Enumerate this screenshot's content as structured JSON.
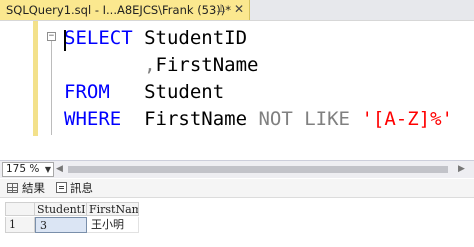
{
  "tab": {
    "title": "SQLQuery1.sql - I...A8EJCS\\Frank (53))*",
    "pin_glyph": "⊥",
    "close_glyph": "✕"
  },
  "editor": {
    "fold_glyph": "−",
    "lines": [
      [
        {
          "t": "SELECT",
          "c": "kw"
        },
        {
          "t": " StudentID",
          "c": "id"
        }
      ],
      [
        {
          "t": "       ",
          "c": "id"
        },
        {
          "t": ",",
          "c": "op"
        },
        {
          "t": "FirstName",
          "c": "id"
        }
      ],
      [
        {
          "t": "FROM",
          "c": "kw"
        },
        {
          "t": "   Student",
          "c": "id"
        }
      ],
      [
        {
          "t": "WHERE",
          "c": "kw"
        },
        {
          "t": "  FirstName ",
          "c": "id"
        },
        {
          "t": "NOT LIKE",
          "c": "op"
        },
        {
          "t": " ",
          "c": "id"
        },
        {
          "t": "'[A-Z]%'",
          "c": "str"
        }
      ]
    ]
  },
  "zoom": {
    "value": "175 %",
    "arrow": "▼"
  },
  "result_tabs": {
    "results_label": "結果",
    "messages_label": "訊息"
  },
  "grid": {
    "columns": [
      "StudentID",
      "FirstName"
    ],
    "rows": [
      {
        "num": "1",
        "cells": [
          "3",
          "王小明"
        ]
      }
    ]
  }
}
